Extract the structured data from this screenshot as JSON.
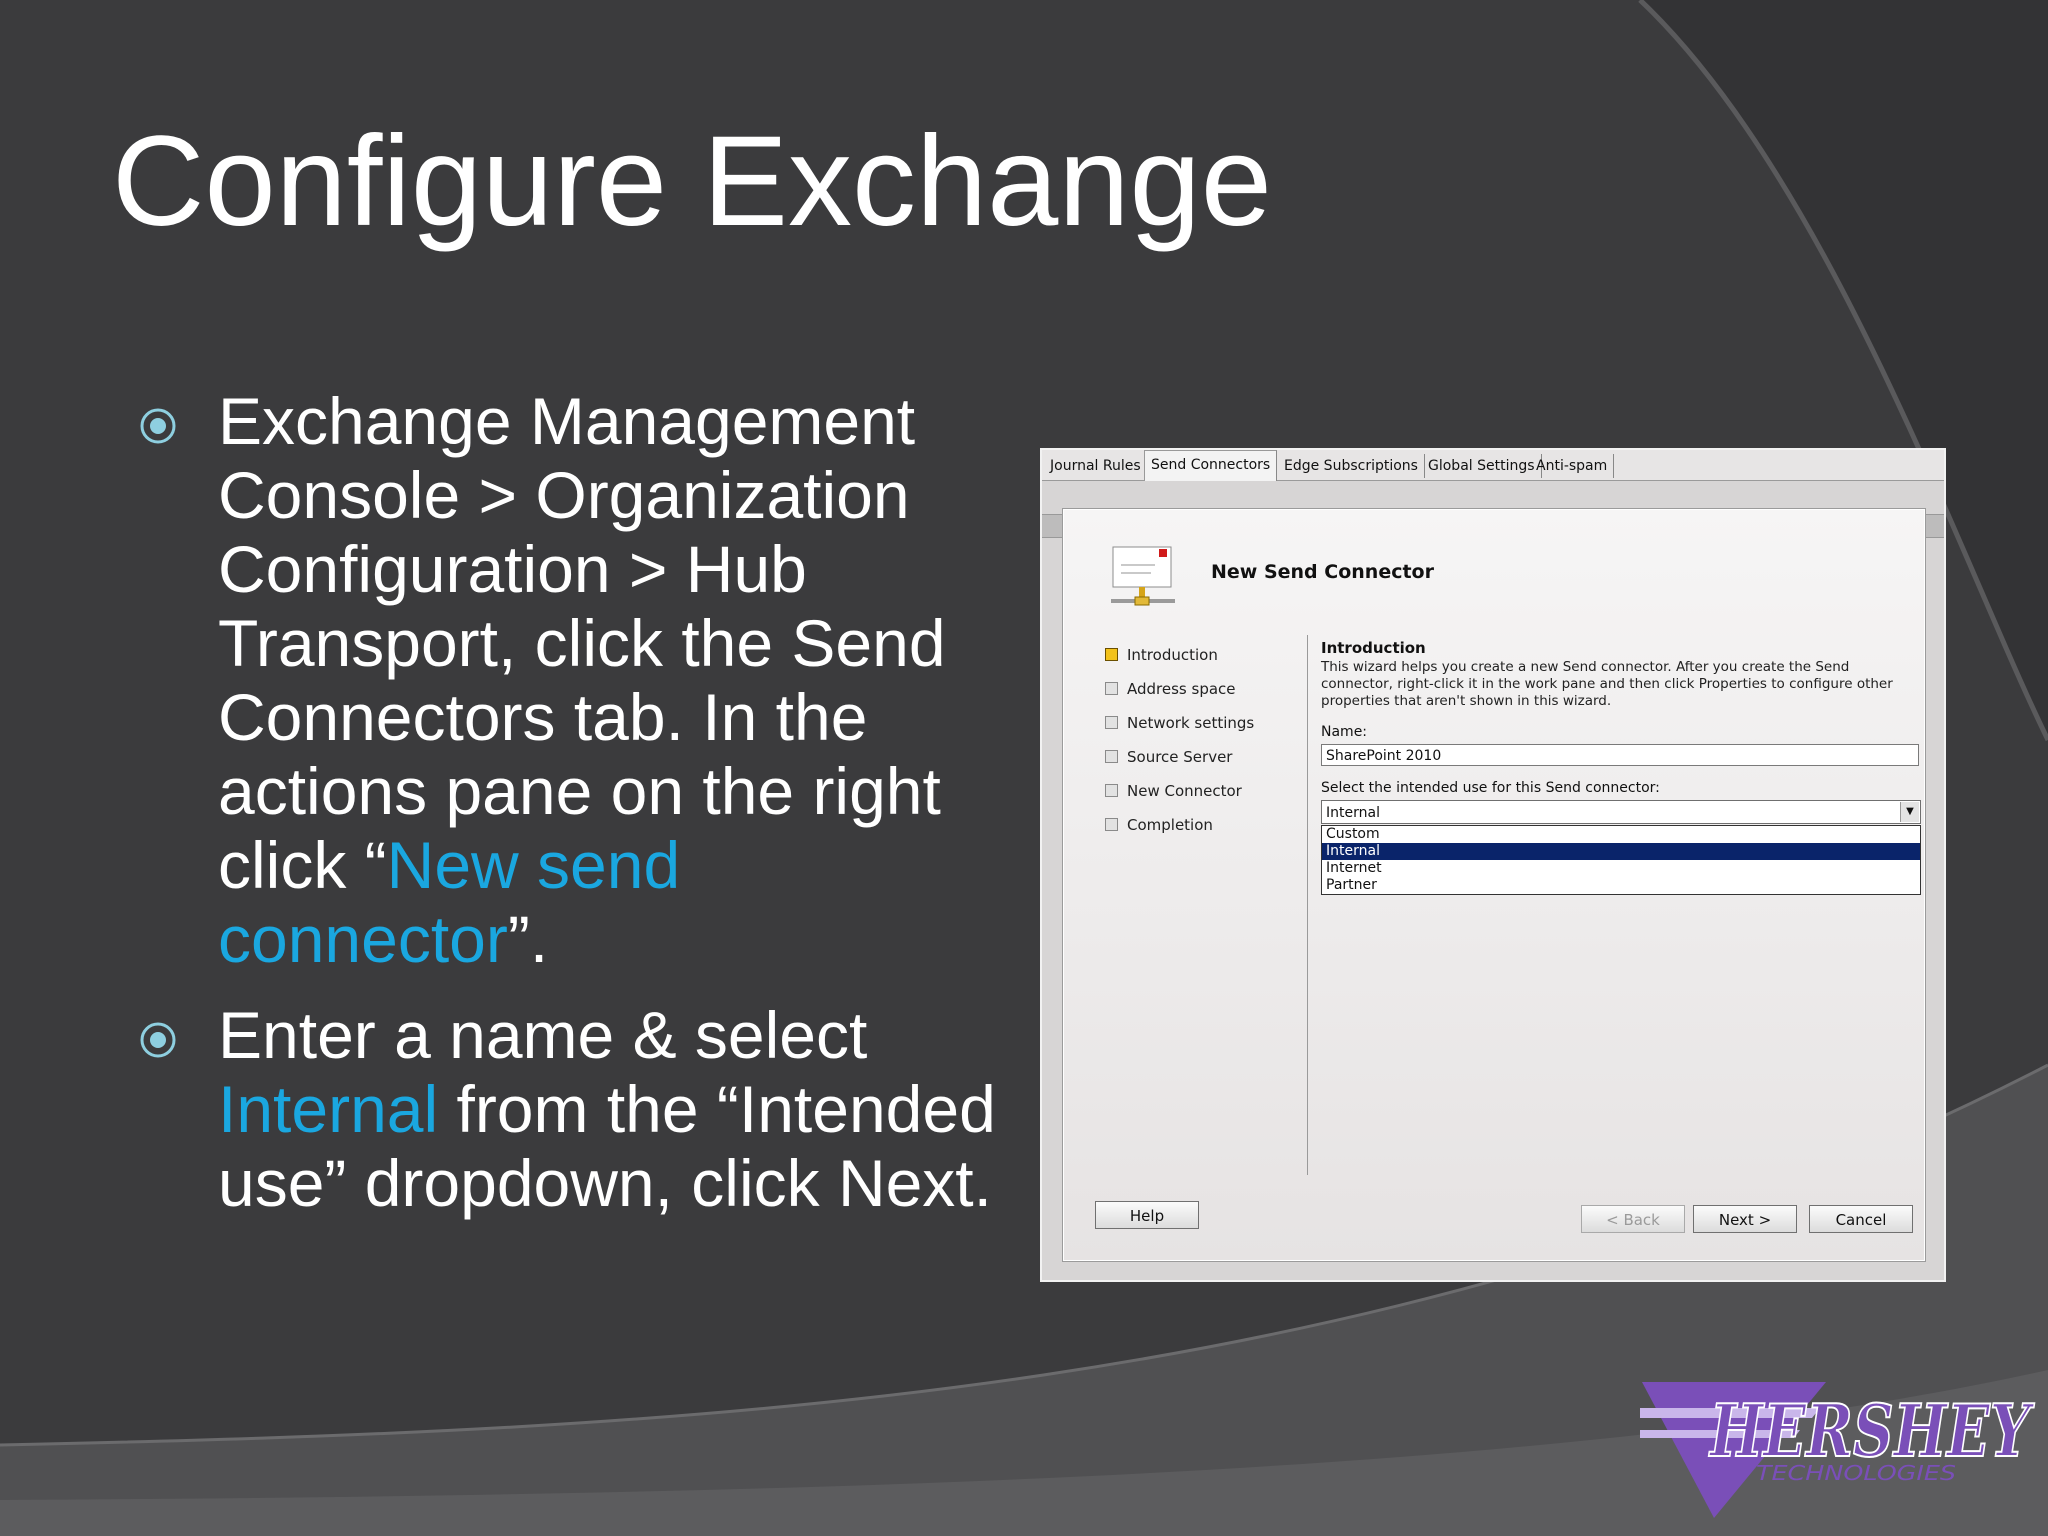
{
  "slide": {
    "title": "Configure Exchange",
    "bullets": [
      {
        "parts": [
          {
            "text": "Exchange Management Console > Organization Configuration > Hub Transport, click the Send Connectors tab. In the actions pane on the right click “",
            "highlight": false
          },
          {
            "text": "New send connector",
            "highlight": true
          },
          {
            "text": "”.",
            "highlight": false
          }
        ]
      },
      {
        "parts": [
          {
            "text": "Enter a name & select ",
            "highlight": false
          },
          {
            "text": "Internal",
            "highlight": true
          },
          {
            "text": " from the “Intended use” dropdown, click Next.",
            "highlight": false
          }
        ]
      }
    ]
  },
  "screenshot": {
    "tabs": [
      "Journal Rules",
      "Send Connectors",
      "Edge Subscriptions",
      "Global Settings",
      "Anti-spam"
    ],
    "active_tab": "Send Connectors",
    "dialog": {
      "title": "New Send Connector",
      "steps": [
        {
          "label": "Introduction",
          "active": true
        },
        {
          "label": "Address space",
          "active": false
        },
        {
          "label": "Network settings",
          "active": false
        },
        {
          "label": "Source Server",
          "active": false
        },
        {
          "label": "New Connector",
          "active": false
        },
        {
          "label": "Completion",
          "active": false
        }
      ],
      "heading": "Introduction",
      "description": "This wizard helps you create a new Send connector. After you create the Send connector, right-click it in the work pane and then click Properties to configure other properties that aren't shown in this wizard.",
      "name_label": "Name:",
      "name_value": "SharePoint 2010",
      "intended_use_label": "Select the intended use for this Send connector:",
      "intended_use_value": "Internal",
      "intended_use_options": [
        "Custom",
        "Internal",
        "Internet",
        "Partner"
      ],
      "intended_use_selected": "Internal",
      "buttons": {
        "help": "Help",
        "back": "< Back",
        "next": "Next >",
        "cancel": "Cancel"
      }
    }
  },
  "logo": {
    "name": "HERSHEY",
    "subtitle": "TECHNOLOGIES"
  },
  "colors": {
    "background": "#3b3b3d",
    "highlight": "#1aa7e0",
    "logo": "#7a4fb8"
  }
}
